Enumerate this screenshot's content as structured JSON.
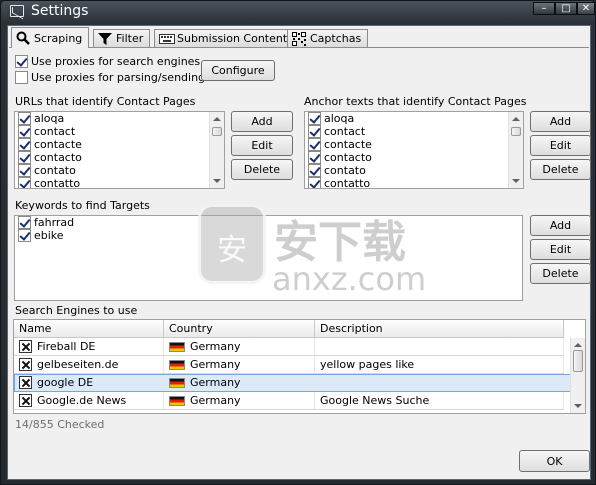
{
  "window": {
    "title": "Settings"
  },
  "tabs": [
    {
      "label": "Scraping",
      "icon": "magnifier-icon"
    },
    {
      "label": "Filter",
      "icon": "funnel-icon"
    },
    {
      "label": "Submission Content",
      "icon": "keyboard-icon"
    },
    {
      "label": "Captchas",
      "icon": "qr-code-icon"
    }
  ],
  "proxy_options": {
    "search_engines_label": "Use proxies for search engines",
    "search_engines_checked": true,
    "parsing_label": "Use proxies for parsing/sending",
    "parsing_checked": false,
    "configure_label": "Configure"
  },
  "contact_urls": {
    "heading": "URLs that identify Contact Pages",
    "items": [
      "aloqa",
      "contact",
      "contacte",
      "contacto",
      "contato",
      "contatto"
    ],
    "add_label": "Add",
    "edit_label": "Edit",
    "delete_label": "Delete"
  },
  "anchor_texts": {
    "heading": "Anchor texts that identify Contact Pages",
    "items": [
      "aloqa",
      "contact",
      "contacte",
      "contacto",
      "contato",
      "contatto"
    ],
    "add_label": "Add",
    "edit_label": "Edit",
    "delete_label": "Delete"
  },
  "keywords": {
    "heading": "Keywords to find Targets",
    "items": [
      "fahrrad",
      "ebike"
    ],
    "add_label": "Add",
    "edit_label": "Edit",
    "delete_label": "Delete"
  },
  "search_engines": {
    "heading": "Search Engines to use",
    "columns": [
      "Name",
      "Country",
      "Description"
    ],
    "rows": [
      {
        "name": "Fireball DE",
        "country": "Germany",
        "description": ""
      },
      {
        "name": "gelbeseiten.de",
        "country": "Germany",
        "description": "yellow pages like"
      },
      {
        "name": "google DE",
        "country": "Germany",
        "description": ""
      },
      {
        "name": "Google.de News",
        "country": "Germany",
        "description": "Google News Suche"
      }
    ],
    "selected_row": 2,
    "status": "14/855 Checked"
  },
  "footer": {
    "ok_label": "OK"
  },
  "watermark": {
    "cn_text": "安下载",
    "en_text": "anxz.com",
    "badge_text": "安"
  },
  "colors": {
    "selection": "#dceaf8",
    "title_bar": "#2a3138"
  }
}
